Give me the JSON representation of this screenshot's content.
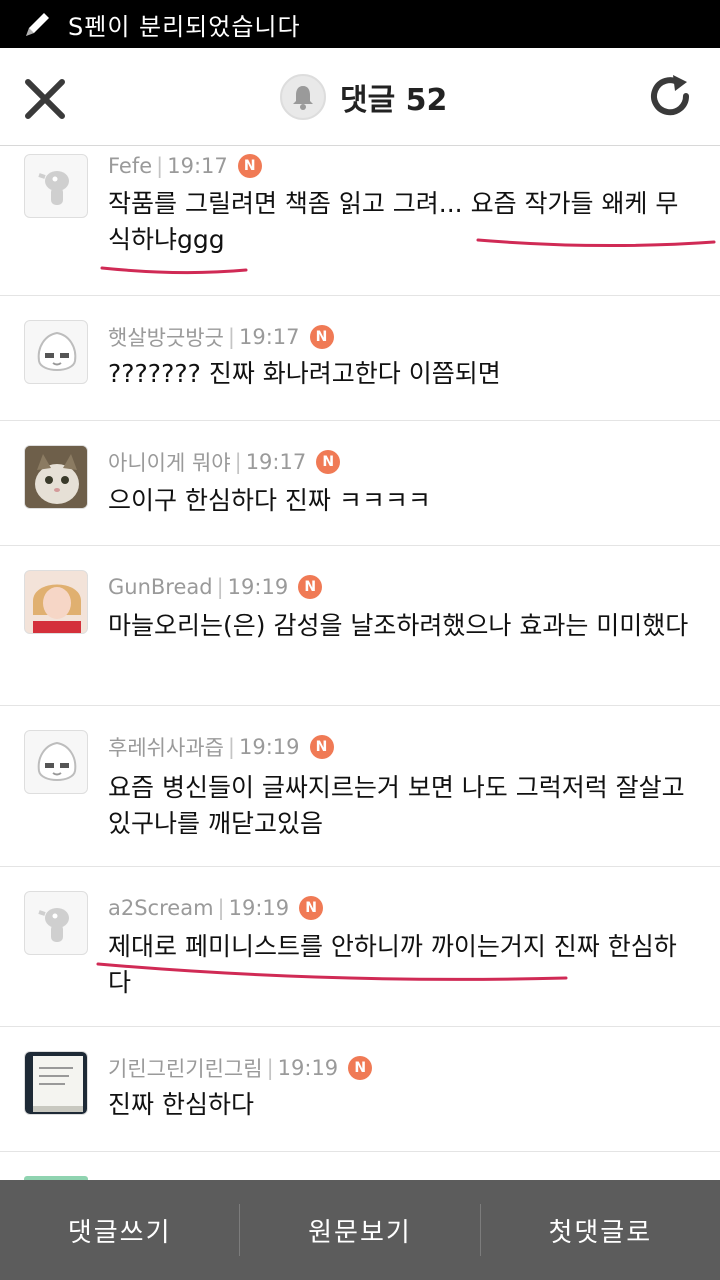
{
  "status_bar": {
    "text": "S펜이 분리되었습니다"
  },
  "header": {
    "title": "댓글 52"
  },
  "comments": [
    {
      "author": "Fefe",
      "time": "19:17",
      "badge": "N",
      "text": "작품를 그릴려면 책좀 읽고 그려... 요즘 작가들 왜케 무식하냐ggg",
      "avatar": "default-character"
    },
    {
      "author": "햇살방긋방긋",
      "time": "19:17",
      "badge": "N",
      "text": "??????? 진짜 화나려고한다 이쯤되면",
      "avatar": "peach-character"
    },
    {
      "author": "아니이게 뭐야",
      "time": "19:17",
      "badge": "N",
      "text": "으이구 한심하다 진짜 ㅋㅋㅋㅋ",
      "avatar": "cat-photo"
    },
    {
      "author": "GunBread",
      "time": "19:19",
      "badge": "N",
      "text": "마늘오리는(은) 감성을 날조하려했으나 효과는 미미했다",
      "avatar": "person-photo"
    },
    {
      "author": "후레쉬사과즙",
      "time": "19:19",
      "badge": "N",
      "text": "요즘 병신들이 글싸지르는거 보면 나도 그럭저럭 잘살고있구나를 깨닫고있음",
      "avatar": "peach-character"
    },
    {
      "author": "a2Scream",
      "time": "19:19",
      "badge": "N",
      "text": "제대로 페미니스트를 안하니까 까이는거지 진짜 한심하다",
      "avatar": "default-character"
    },
    {
      "author": "기린그린기린그림",
      "time": "19:19",
      "badge": "N",
      "text": "진짜 한심하다",
      "avatar": "paper-photo"
    }
  ],
  "bottom_bar": {
    "write": "댓글쓰기",
    "original": "원문보기",
    "first": "첫댓글로"
  },
  "colors": {
    "badge": "#f07a55",
    "underline": "#d02a55",
    "bottom_bar": "#5c5c5c"
  }
}
